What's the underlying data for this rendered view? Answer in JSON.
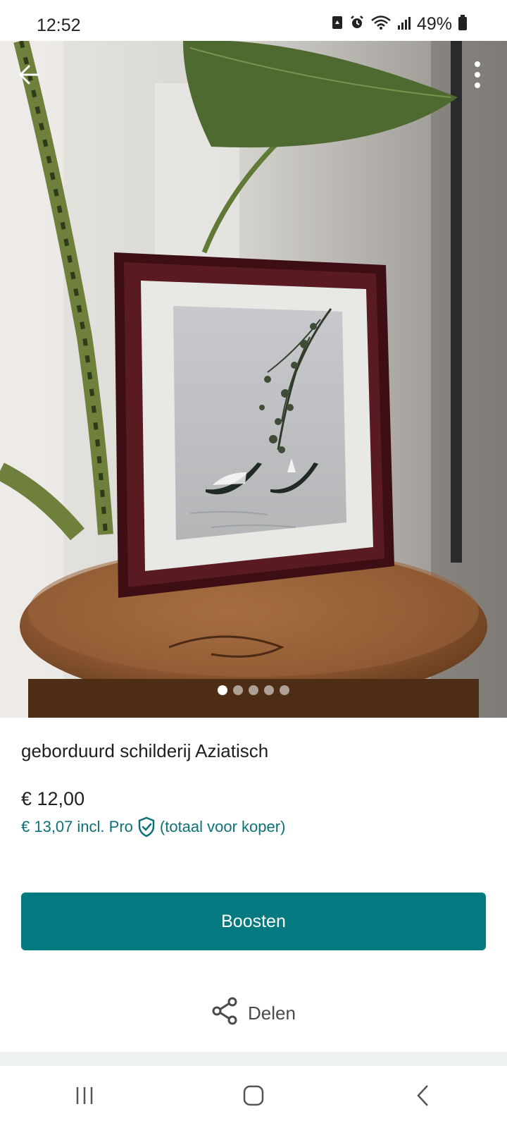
{
  "status_bar": {
    "time": "12:52",
    "battery": "49%",
    "icons": [
      "sim-icon",
      "alarm-icon",
      "wifi-icon",
      "signal-icon",
      "battery-icon"
    ]
  },
  "photo": {
    "page_count": 5,
    "active_index": 0
  },
  "header": {
    "back_icon": "arrow-left-icon",
    "menu_icon": "more-vertical-icon"
  },
  "listing": {
    "title": "geborduurd schilderij Aziatisch",
    "price": "€ 12,00",
    "buyer_price": "€ 13,07",
    "buyer_label": "incl. Pro",
    "buyer_suffix": "(totaal voor koper)"
  },
  "actions": {
    "boost_label": "Boosten",
    "share_label": "Delen"
  },
  "colors": {
    "accent": "#047a80",
    "accent_text": "#0d7278"
  }
}
